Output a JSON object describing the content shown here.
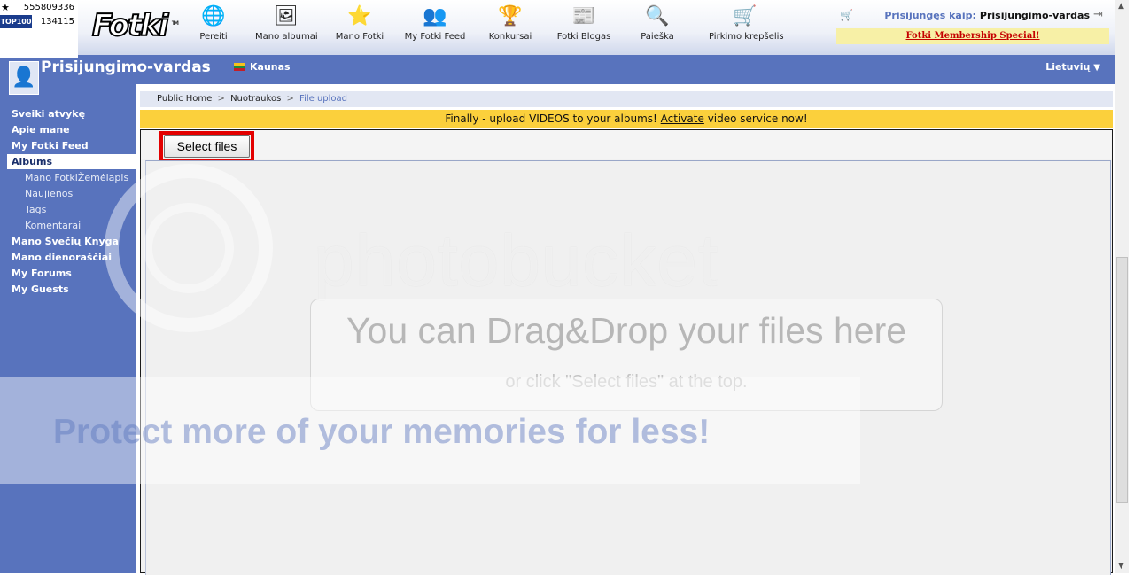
{
  "counter": {
    "top_value": "555809336",
    "top100_label": "TOP100",
    "top100_value": "134115"
  },
  "header": {
    "logo_text": "Fotki",
    "logo_tm": "TM",
    "nav": [
      {
        "label": "Pereiti",
        "icon": "globe-icon",
        "glyph": "🌐"
      },
      {
        "label": "Mano albumai",
        "icon": "albums-icon",
        "glyph": "🖼"
      },
      {
        "label": "Mano Fotki",
        "icon": "star-icon",
        "glyph": "⭐"
      },
      {
        "label": "My Fotki Feed",
        "icon": "people-icon",
        "glyph": "👥"
      },
      {
        "label": "Konkursai",
        "icon": "podium-icon",
        "glyph": "🏆"
      },
      {
        "label": "Fotki Blogas",
        "icon": "blog-new-icon",
        "glyph": "📰"
      },
      {
        "label": "Paieška",
        "icon": "magnifier-icon",
        "glyph": "🔍"
      },
      {
        "label": "Pirkimo krepšelis",
        "icon": "shopping-cart-icon",
        "glyph": "🛒"
      }
    ],
    "login_label": "Prisijungęs kaip:",
    "login_user": "Prisijungimo-vardas",
    "membership_text": "Fotki Membership Special!"
  },
  "profile": {
    "name": "Prisijungimo-vardas",
    "city": "Kaunas",
    "language": "Lietuvių"
  },
  "sidebar": {
    "items": [
      {
        "label": "Sveiki atvykę",
        "type": "main"
      },
      {
        "label": "Apie mane",
        "type": "main"
      },
      {
        "label": "My Fotki Feed",
        "type": "main"
      },
      {
        "label": "Albums",
        "type": "active"
      },
      {
        "label": "Mano FotkiŽemėlapis",
        "type": "sub"
      },
      {
        "label": "Naujienos",
        "type": "sub"
      },
      {
        "label": "Tags",
        "type": "sub"
      },
      {
        "label": "Komentarai",
        "type": "sub"
      },
      {
        "label": "Mano Svečių Knyga",
        "type": "main"
      },
      {
        "label": "Mano dienoraščiai",
        "type": "main"
      },
      {
        "label": "My Forums",
        "type": "main"
      },
      {
        "label": "My Guests",
        "type": "main"
      }
    ]
  },
  "breadcrumb": {
    "home": "Public Home",
    "section": "Nuotraukos",
    "current": "File upload",
    "separator": ">"
  },
  "banner": {
    "before": "Finally - upload VIDEOS to your albums!",
    "link": "Activate",
    "after": "video service now!"
  },
  "upload": {
    "select_button": "Select files",
    "drop_title": "You can Drag&Drop your files here",
    "drop_sub": "or click \"Select files\" at the top."
  },
  "watermark": {
    "brand": "photobucket",
    "band_text": "Protect more of your memories for less!"
  },
  "colors": {
    "brand_blue": "#5873bd",
    "banner_yellow": "#fbd03c",
    "highlight_red": "#e30000",
    "membership_red": "#c40000"
  }
}
